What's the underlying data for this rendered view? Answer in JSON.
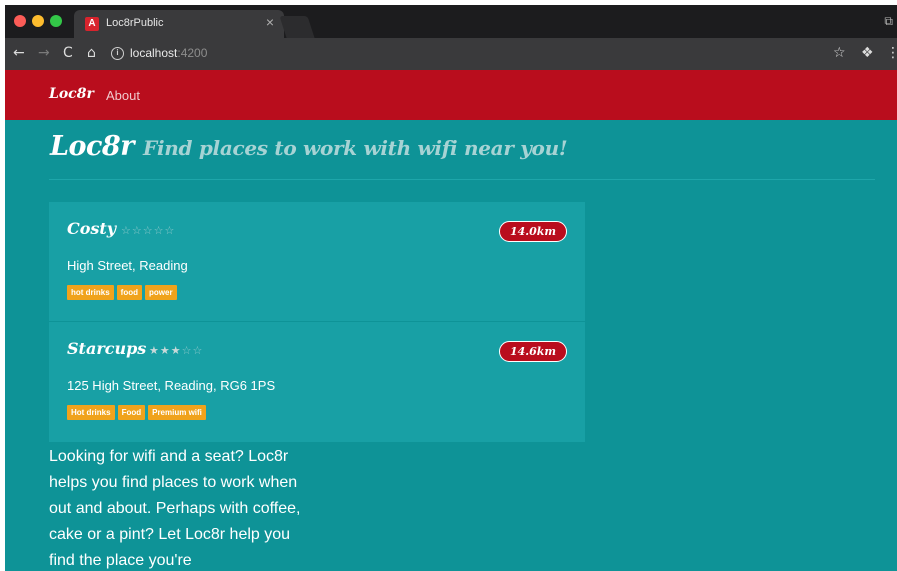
{
  "browser": {
    "tab_title": "Loc8rPublic",
    "tab_favicon_letter": "A",
    "tab_close": "×",
    "url_host": "localhost",
    "url_port": ":4200",
    "icons": {
      "back": "←",
      "forward": "→",
      "reload": "C",
      "home": "⌂",
      "info": "i",
      "star": "☆",
      "extension": "❖",
      "menu": "⋮",
      "window": "⧉"
    }
  },
  "navbar": {
    "brand": "Loc8r",
    "links": [
      "About"
    ]
  },
  "header": {
    "title": "Loc8r",
    "strapline": "Find places to work with wifi near you!"
  },
  "locations": [
    {
      "name": "Costy",
      "rating": 0,
      "rating_max": 5,
      "distance": "14.0km",
      "address": "High Street, Reading",
      "facilities": [
        "hot drinks",
        "food",
        "power"
      ]
    },
    {
      "name": "Starcups",
      "rating": 3,
      "rating_max": 5,
      "distance": "14.6km",
      "address": "125 High Street, Reading, RG6 1PS",
      "facilities": [
        "Hot drinks",
        "Food",
        "Premium wifi"
      ]
    }
  ],
  "sidebar": {
    "text": "Looking for wifi and a seat? Loc8r helps you find places to work when out and about. Perhaps with coffee, cake or a pint? Let Loc8r help you find the place you're"
  },
  "colors": {
    "page_bg": "#0e9397",
    "card_bg": "#18a0a5",
    "navbar_bg": "#b90d1d",
    "badge_bg": "#b90d1d",
    "tag_bg": "#f0a31c"
  }
}
